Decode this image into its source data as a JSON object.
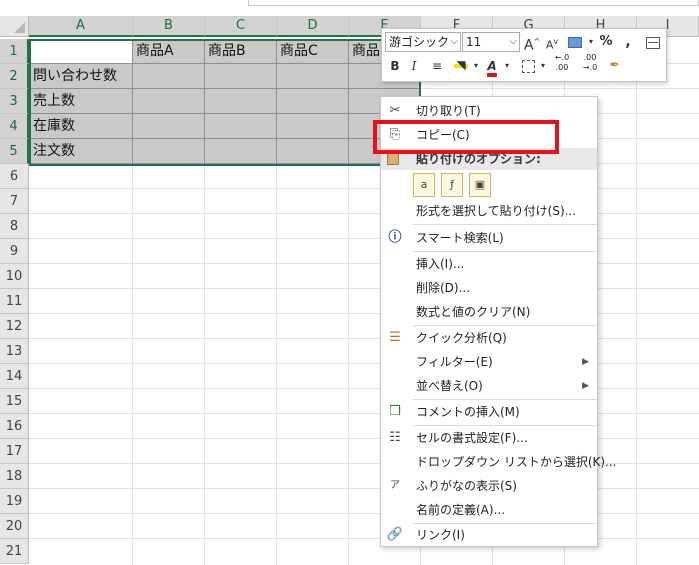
{
  "sheet": {
    "columns": [
      "A",
      "B",
      "C",
      "D",
      "E",
      "F",
      "G",
      "H",
      "I"
    ],
    "rows": [
      "1",
      "2",
      "3",
      "4",
      "5",
      "6",
      "7",
      "8",
      "9",
      "10",
      "11",
      "12",
      "13",
      "14",
      "15",
      "16",
      "17",
      "18",
      "19",
      "20",
      "21"
    ],
    "headers": [
      "商品A",
      "商品B",
      "商品C",
      "商品"
    ],
    "row_labels": [
      "問い合わせ数",
      "売上数",
      "在庫数",
      "注文数"
    ]
  },
  "minitoolbar": {
    "font_name": "游ゴシック",
    "font_size": "11",
    "grow_font": "A",
    "shrink_font": "A",
    "percent": "%",
    "comma": ",",
    "bold": "B",
    "italic": "I",
    "font_color_letter": "A",
    "dec_increase": "←.0\n.00",
    "dec_decrease": ".00\n→.0"
  },
  "context_menu": {
    "cut": "切り取り(T)",
    "copy": "コピー(C)",
    "paste_options": "貼り付けのオプション:",
    "paste_special": "形式を選択して貼り付け(S)...",
    "smart_lookup": "スマート検索(L)",
    "insert": "挿入(I)...",
    "delete": "削除(D)...",
    "clear_contents": "数式と値のクリア(N)",
    "quick_analysis": "クイック分析(Q)",
    "filter": "フィルター(E)",
    "sort": "並べ替え(O)",
    "insert_comment": "コメントの挿入(M)",
    "format_cells": "セルの書式設定(F)...",
    "pick_from_list": "ドロップダウン リストから選択(K)...",
    "phonetic": "ふりがなの表示(S)",
    "define_name": "名前の定義(A)...",
    "link": "リンク(I)"
  },
  "colors": {
    "accent_green": "#217346",
    "highlight_red": "#e8101a",
    "cell_shading": "#c9c9c9"
  }
}
